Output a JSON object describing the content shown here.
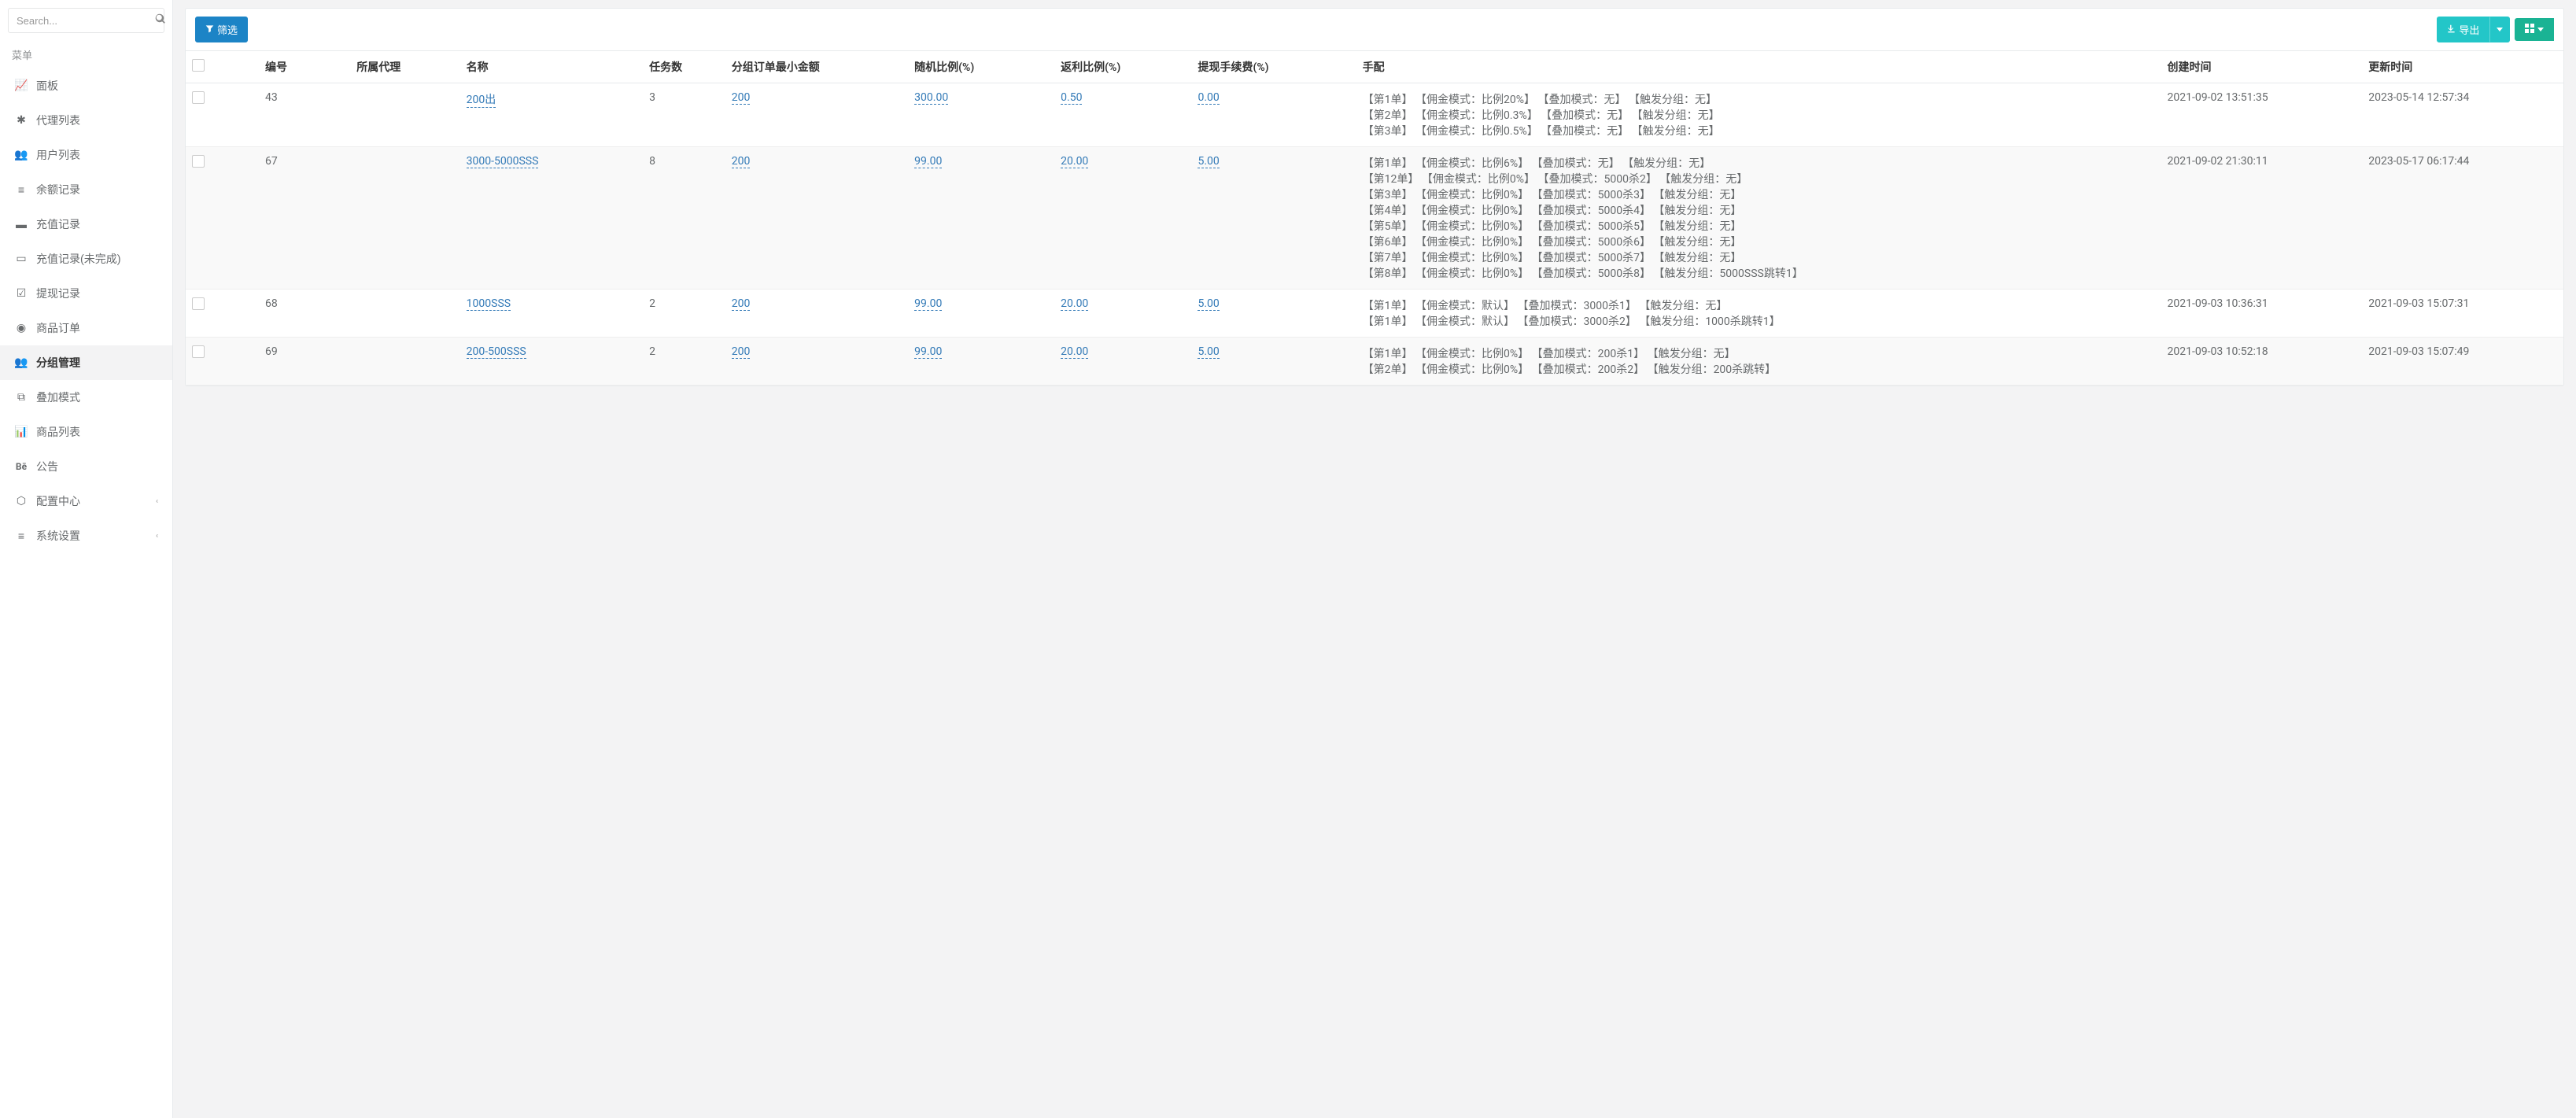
{
  "search": {
    "placeholder": "Search..."
  },
  "sidebar": {
    "header": "菜单",
    "items": [
      {
        "label": "面板"
      },
      {
        "label": "代理列表"
      },
      {
        "label": "用户列表"
      },
      {
        "label": "余额记录"
      },
      {
        "label": "充值记录"
      },
      {
        "label": "充值记录(未完成)"
      },
      {
        "label": "提现记录"
      },
      {
        "label": "商品订单"
      },
      {
        "label": "分组管理"
      },
      {
        "label": "叠加模式"
      },
      {
        "label": "商品列表"
      },
      {
        "label": "公告"
      },
      {
        "label": "配置中心"
      },
      {
        "label": "系统设置"
      }
    ]
  },
  "toolbar": {
    "filter_label": "筛选",
    "export_label": "导出"
  },
  "table": {
    "headers": {
      "id": "编号",
      "agent": "所属代理",
      "name": "名称",
      "tasks": "任务数",
      "min_amount": "分组订单最小金额",
      "random_pct": "随机比例(%)",
      "rebate_pct": "返利比例(%)",
      "fee_pct": "提现手续费(%)",
      "hand_match": "手配",
      "created": "创建时间",
      "updated": "更新时间"
    },
    "rows": [
      {
        "id": "43",
        "agent": "",
        "name": "200出",
        "tasks": "3",
        "min_amount": "200",
        "random_pct": "300.00",
        "rebate_pct": "0.50",
        "fee_pct": "0.00",
        "hand_match": "【第1单】 【佣金模式：比例20%】 【叠加模式：无】 【触发分组：无】\n【第2单】 【佣金模式：比例0.3%】 【叠加模式：无】 【触发分组：无】\n【第3单】 【佣金模式：比例0.5%】 【叠加模式：无】 【触发分组：无】",
        "created": "2021-09-02 13:51:35",
        "updated": "2023-05-14 12:57:34"
      },
      {
        "id": "67",
        "agent": "",
        "name": "3000-5000SSS",
        "tasks": "8",
        "min_amount": "200",
        "random_pct": "99.00",
        "rebate_pct": "20.00",
        "fee_pct": "5.00",
        "hand_match": "【第1单】 【佣金模式：比例6%】 【叠加模式：无】 【触发分组：无】\n【第12单】 【佣金模式：比例0%】 【叠加模式：5000杀2】 【触发分组：无】\n【第3单】 【佣金模式：比例0%】 【叠加模式：5000杀3】 【触发分组：无】\n【第4单】 【佣金模式：比例0%】 【叠加模式：5000杀4】 【触发分组：无】\n【第5单】 【佣金模式：比例0%】 【叠加模式：5000杀5】 【触发分组：无】\n【第6单】 【佣金模式：比例0%】 【叠加模式：5000杀6】 【触发分组：无】\n【第7单】 【佣金模式：比例0%】 【叠加模式：5000杀7】 【触发分组：无】\n【第8单】 【佣金模式：比例0%】 【叠加模式：5000杀8】 【触发分组：5000SSS跳转1】",
        "created": "2021-09-02 21:30:11",
        "updated": "2023-05-17 06:17:44"
      },
      {
        "id": "68",
        "agent": "",
        "name": "1000SSS",
        "tasks": "2",
        "min_amount": "200",
        "random_pct": "99.00",
        "rebate_pct": "20.00",
        "fee_pct": "5.00",
        "hand_match": "【第1单】 【佣金模式：默认】 【叠加模式：3000杀1】 【触发分组：无】\n【第1单】 【佣金模式：默认】 【叠加模式：3000杀2】 【触发分组：1000杀跳转1】",
        "created": "2021-09-03 10:36:31",
        "updated": "2021-09-03 15:07:31"
      },
      {
        "id": "69",
        "agent": "",
        "name": "200-500SSS",
        "tasks": "2",
        "min_amount": "200",
        "random_pct": "99.00",
        "rebate_pct": "20.00",
        "fee_pct": "5.00",
        "hand_match": "【第1单】 【佣金模式：比例0%】 【叠加模式：200杀1】 【触发分组：无】\n【第2单】 【佣金模式：比例0%】 【叠加模式：200杀2】 【触发分组：200杀跳转】",
        "created": "2021-09-03 10:52:18",
        "updated": "2021-09-03 15:07:49"
      }
    ]
  }
}
